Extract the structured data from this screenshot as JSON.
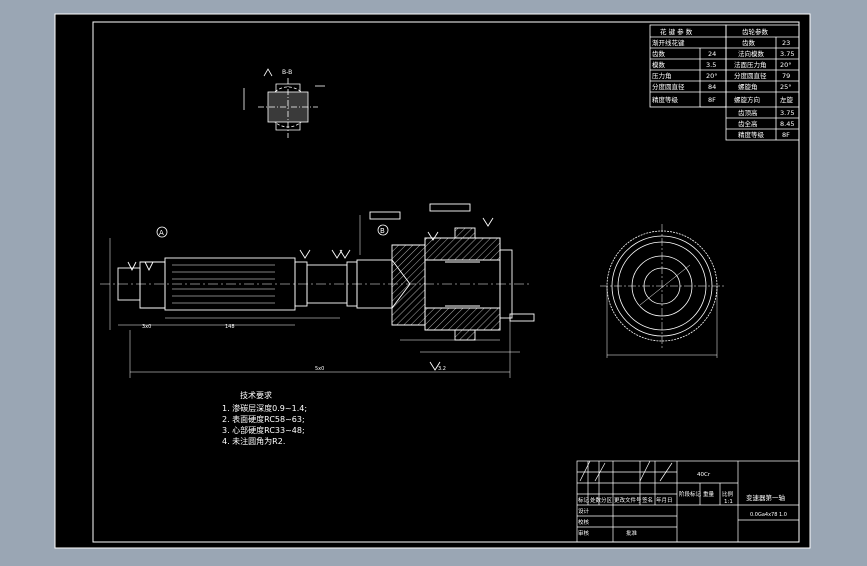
{
  "colors": {
    "frame_bg": "#7f8a96",
    "canvas": "#000000",
    "line": "#ffffff",
    "hatch": "#d8d8d8"
  },
  "section_label": "B-B",
  "datum_a": "A",
  "datum_b": "B",
  "tech_requirements": {
    "title": "技术要求",
    "items": [
      "1. 渗碳层深度0.9~1.4;",
      "2. 表面硬度RC58~63;",
      "3. 心部硬度RC33~48;",
      "4. 未注圆角为R2."
    ]
  },
  "table_spline": {
    "title": "花 键 参 数",
    "rows": [
      [
        "渐开线花键",
        "",
        ""
      ],
      [
        "齿数",
        "24"
      ],
      [
        "模数",
        "3.5"
      ],
      [
        "压力角",
        "20°"
      ],
      [
        "分度圆直径",
        "84"
      ],
      [
        "精度等级",
        "8F"
      ]
    ]
  },
  "table_gear": {
    "title": "齿轮参数",
    "rows": [
      [
        "齿数",
        "23"
      ],
      [
        "法向模数",
        "3.75"
      ],
      [
        "法面压力角",
        "20°"
      ],
      [
        "分度圆直径",
        "79"
      ],
      [
        "螺旋角",
        "25°"
      ],
      [
        "螺旋方向",
        "左旋"
      ],
      [
        "齿顶高",
        "3.75"
      ],
      [
        "齿全高",
        "8.45"
      ],
      [
        "精度等级",
        "8F"
      ]
    ]
  },
  "title_block": {
    "part_name": "变速器第一轴",
    "drawing_no": "0.0Ga4x78 1.0",
    "scale": "1:1",
    "material": "40Cr",
    "header_cells": [
      "标记",
      "处数",
      "分区",
      "更改文件号",
      "签名",
      "年月日"
    ],
    "label_cells": [
      "设计",
      "校核",
      "审核",
      "工艺",
      "标准化",
      "批准"
    ],
    "weight_cells": [
      "阶段标记",
      "重量",
      "比例"
    ]
  },
  "dim_total": "5x0",
  "dim_left": "3x0",
  "dim_mid": "148",
  "roughness": "3.2"
}
